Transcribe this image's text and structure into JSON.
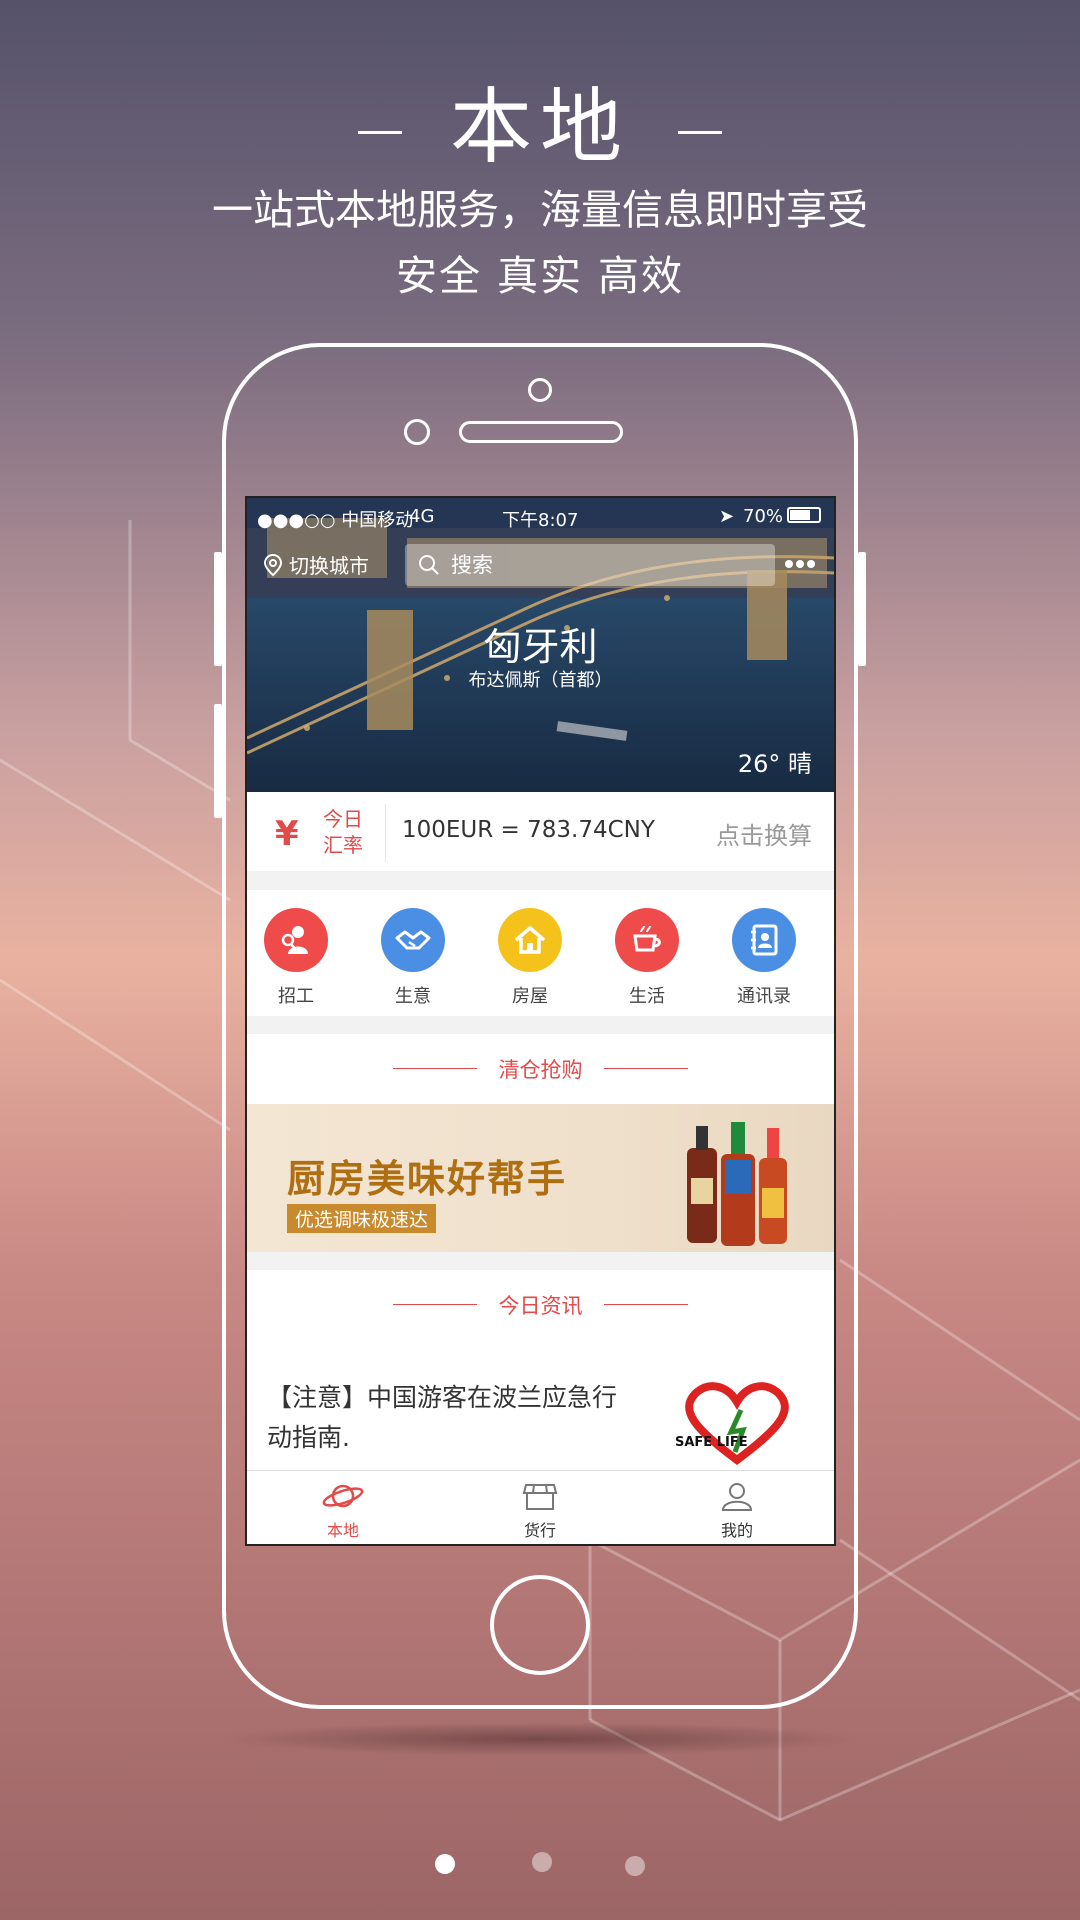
{
  "header": {
    "title": "本地",
    "subtitle": "一站式本地服务，海量信息即时享受",
    "tagline": "安全 真实 高效"
  },
  "status_bar": {
    "carrier": "●●●○○ 中国移动",
    "network": "4G",
    "time": "下午8:07",
    "battery": "70%"
  },
  "top_bar": {
    "switch_city": "切换城市",
    "search_placeholder": "搜索"
  },
  "hero": {
    "country": "匈牙利",
    "capital": "布达佩斯（首都）",
    "weather": "26° 晴"
  },
  "exchange": {
    "icon": "yen-icon",
    "label": "今日汇率",
    "value": "100EUR = 783.74CNY",
    "action": "点击换算"
  },
  "categories": [
    {
      "label": "招工",
      "icon": "worker-icon",
      "color": "#ef4b4b"
    },
    {
      "label": "生意",
      "icon": "handshake-icon",
      "color": "#4a8fe3"
    },
    {
      "label": "房屋",
      "icon": "house-icon",
      "color": "#f5c21b"
    },
    {
      "label": "生活",
      "icon": "coffee-cup-icon",
      "color": "#ef4b4b"
    },
    {
      "label": "通讯录",
      "icon": "contacts-icon",
      "color": "#4a8fe3"
    }
  ],
  "sections": {
    "clearance": "清仓抢购",
    "news": "今日资讯"
  },
  "banner": {
    "title": "厨房美味好帮手",
    "subtitle": "优选调味极速达"
  },
  "news_item": {
    "title": "【注意】中国游客在波兰应急行动指南.",
    "image_text": "SAFE LIFE"
  },
  "tabbar": {
    "items": [
      {
        "label": "本地",
        "icon": "planet-icon",
        "active": true
      },
      {
        "label": "货行",
        "icon": "store-icon",
        "active": false
      },
      {
        "label": "我的",
        "icon": "user-icon",
        "active": false
      }
    ]
  },
  "pager": {
    "count": 3,
    "active_index": 0
  },
  "colors": {
    "accent": "#e34a4a",
    "banner_text": "#b06e12"
  }
}
